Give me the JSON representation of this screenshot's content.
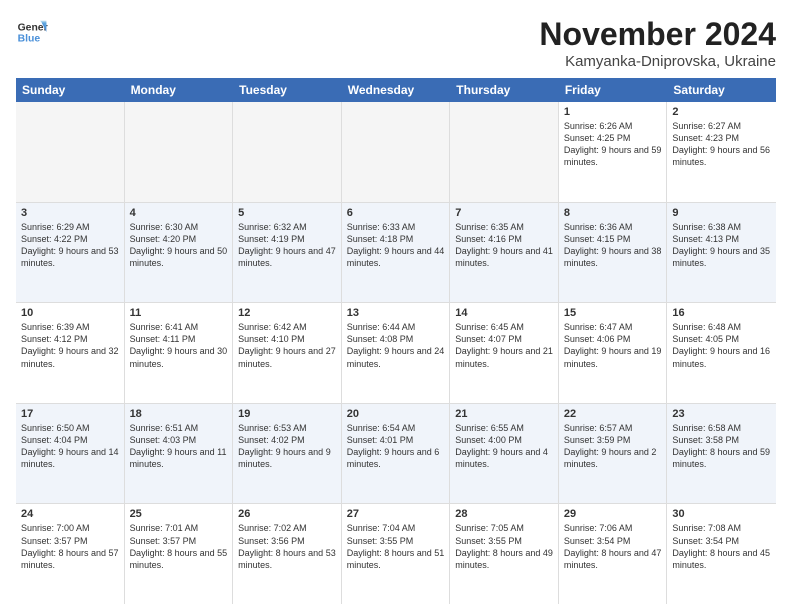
{
  "logo": {
    "line1": "General",
    "line2": "Blue"
  },
  "title": "November 2024",
  "subtitle": "Kamyanka-Dniprovska, Ukraine",
  "days_of_week": [
    "Sunday",
    "Monday",
    "Tuesday",
    "Wednesday",
    "Thursday",
    "Friday",
    "Saturday"
  ],
  "weeks": [
    [
      {
        "day": "",
        "empty": true
      },
      {
        "day": "",
        "empty": true
      },
      {
        "day": "",
        "empty": true
      },
      {
        "day": "",
        "empty": true
      },
      {
        "day": "",
        "empty": true
      },
      {
        "day": "1",
        "sunrise": "6:26 AM",
        "sunset": "4:25 PM",
        "daylight": "9 hours and 59 minutes."
      },
      {
        "day": "2",
        "sunrise": "6:27 AM",
        "sunset": "4:23 PM",
        "daylight": "9 hours and 56 minutes."
      }
    ],
    [
      {
        "day": "3",
        "sunrise": "6:29 AM",
        "sunset": "4:22 PM",
        "daylight": "9 hours and 53 minutes."
      },
      {
        "day": "4",
        "sunrise": "6:30 AM",
        "sunset": "4:20 PM",
        "daylight": "9 hours and 50 minutes."
      },
      {
        "day": "5",
        "sunrise": "6:32 AM",
        "sunset": "4:19 PM",
        "daylight": "9 hours and 47 minutes."
      },
      {
        "day": "6",
        "sunrise": "6:33 AM",
        "sunset": "4:18 PM",
        "daylight": "9 hours and 44 minutes."
      },
      {
        "day": "7",
        "sunrise": "6:35 AM",
        "sunset": "4:16 PM",
        "daylight": "9 hours and 41 minutes."
      },
      {
        "day": "8",
        "sunrise": "6:36 AM",
        "sunset": "4:15 PM",
        "daylight": "9 hours and 38 minutes."
      },
      {
        "day": "9",
        "sunrise": "6:38 AM",
        "sunset": "4:13 PM",
        "daylight": "9 hours and 35 minutes."
      }
    ],
    [
      {
        "day": "10",
        "sunrise": "6:39 AM",
        "sunset": "4:12 PM",
        "daylight": "9 hours and 32 minutes."
      },
      {
        "day": "11",
        "sunrise": "6:41 AM",
        "sunset": "4:11 PM",
        "daylight": "9 hours and 30 minutes."
      },
      {
        "day": "12",
        "sunrise": "6:42 AM",
        "sunset": "4:10 PM",
        "daylight": "9 hours and 27 minutes."
      },
      {
        "day": "13",
        "sunrise": "6:44 AM",
        "sunset": "4:08 PM",
        "daylight": "9 hours and 24 minutes."
      },
      {
        "day": "14",
        "sunrise": "6:45 AM",
        "sunset": "4:07 PM",
        "daylight": "9 hours and 21 minutes."
      },
      {
        "day": "15",
        "sunrise": "6:47 AM",
        "sunset": "4:06 PM",
        "daylight": "9 hours and 19 minutes."
      },
      {
        "day": "16",
        "sunrise": "6:48 AM",
        "sunset": "4:05 PM",
        "daylight": "9 hours and 16 minutes."
      }
    ],
    [
      {
        "day": "17",
        "sunrise": "6:50 AM",
        "sunset": "4:04 PM",
        "daylight": "9 hours and 14 minutes."
      },
      {
        "day": "18",
        "sunrise": "6:51 AM",
        "sunset": "4:03 PM",
        "daylight": "9 hours and 11 minutes."
      },
      {
        "day": "19",
        "sunrise": "6:53 AM",
        "sunset": "4:02 PM",
        "daylight": "9 hours and 9 minutes."
      },
      {
        "day": "20",
        "sunrise": "6:54 AM",
        "sunset": "4:01 PM",
        "daylight": "9 hours and 6 minutes."
      },
      {
        "day": "21",
        "sunrise": "6:55 AM",
        "sunset": "4:00 PM",
        "daylight": "9 hours and 4 minutes."
      },
      {
        "day": "22",
        "sunrise": "6:57 AM",
        "sunset": "3:59 PM",
        "daylight": "9 hours and 2 minutes."
      },
      {
        "day": "23",
        "sunrise": "6:58 AM",
        "sunset": "3:58 PM",
        "daylight": "8 hours and 59 minutes."
      }
    ],
    [
      {
        "day": "24",
        "sunrise": "7:00 AM",
        "sunset": "3:57 PM",
        "daylight": "8 hours and 57 minutes."
      },
      {
        "day": "25",
        "sunrise": "7:01 AM",
        "sunset": "3:57 PM",
        "daylight": "8 hours and 55 minutes."
      },
      {
        "day": "26",
        "sunrise": "7:02 AM",
        "sunset": "3:56 PM",
        "daylight": "8 hours and 53 minutes."
      },
      {
        "day": "27",
        "sunrise": "7:04 AM",
        "sunset": "3:55 PM",
        "daylight": "8 hours and 51 minutes."
      },
      {
        "day": "28",
        "sunrise": "7:05 AM",
        "sunset": "3:55 PM",
        "daylight": "8 hours and 49 minutes."
      },
      {
        "day": "29",
        "sunrise": "7:06 AM",
        "sunset": "3:54 PM",
        "daylight": "8 hours and 47 minutes."
      },
      {
        "day": "30",
        "sunrise": "7:08 AM",
        "sunset": "3:54 PM",
        "daylight": "8 hours and 45 minutes."
      }
    ]
  ]
}
